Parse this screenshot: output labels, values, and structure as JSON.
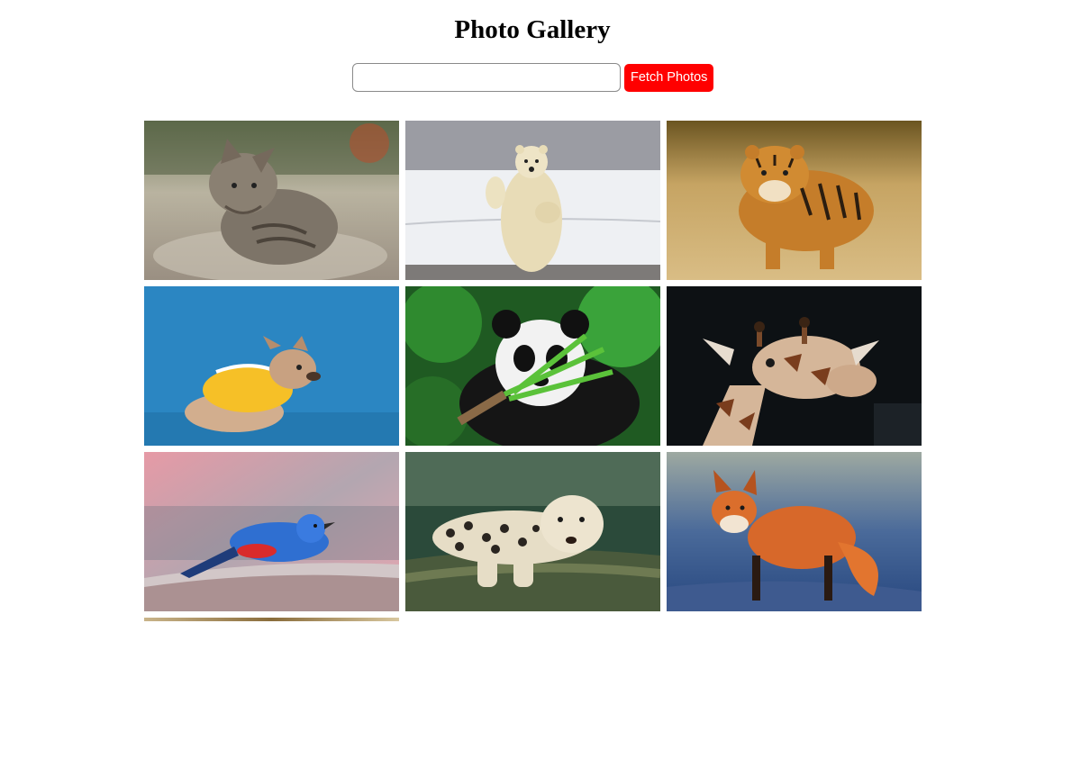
{
  "header": {
    "title": "Photo Gallery"
  },
  "search": {
    "value": "",
    "placeholder": "",
    "button_label": "Fetch Photos"
  },
  "colors": {
    "button_bg": "#ff0000",
    "button_text": "#ffffff",
    "input_border": "#8a8a8a"
  },
  "gallery": {
    "photos": [
      {
        "subject": "kitten"
      },
      {
        "subject": "polar-bear"
      },
      {
        "subject": "tiger"
      },
      {
        "subject": "french-bulldog"
      },
      {
        "subject": "panda"
      },
      {
        "subject": "giraffe"
      },
      {
        "subject": "blue-bird"
      },
      {
        "subject": "leopard"
      },
      {
        "subject": "red-fox"
      },
      {
        "subject": "partial-photo"
      }
    ]
  }
}
